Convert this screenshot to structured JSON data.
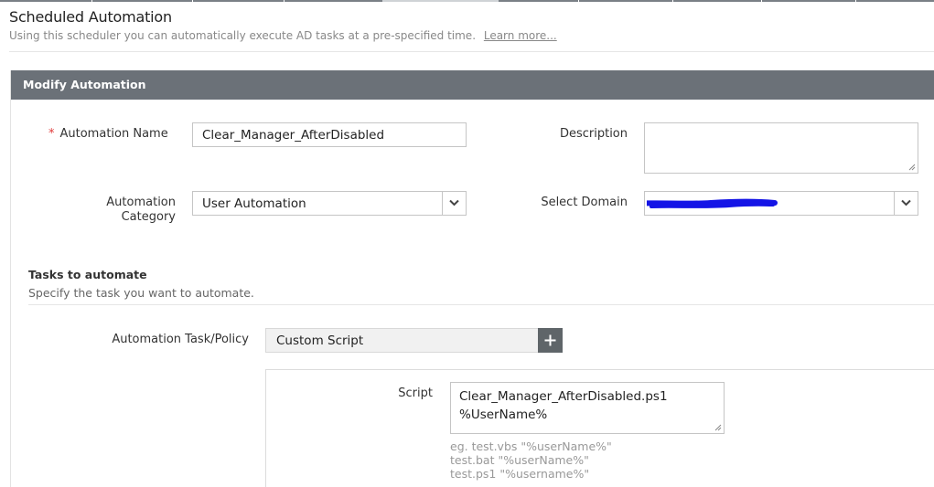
{
  "header": {
    "title": "Scheduled Automation",
    "subtitle": "Using this scheduler you can automatically execute AD tasks at a pre-specified time.",
    "learn_more": "Learn more..."
  },
  "panel": {
    "title": "Modify Automation"
  },
  "form": {
    "automation_name_required": "*",
    "automation_name_label": "Automation Name",
    "automation_name_value": "Clear_Manager_AfterDisabled",
    "description_label": "Description",
    "description_value": "",
    "category_label_line1": "Automation",
    "category_label_line2": "Category",
    "category_value": "User Automation",
    "domain_label": "Select Domain",
    "domain_value": ""
  },
  "tasks": {
    "title": "Tasks to automate",
    "subtitle": "Specify the task you want to automate.",
    "task_label": "Automation Task/Policy",
    "task_value": "Custom Script",
    "add_symbol": "+",
    "script_label": "Script",
    "script_lines": [
      "Clear_Manager_AfterDisabled.ps1",
      "%UserName%"
    ],
    "hints": [
      "eg. test.vbs \"%userName%\"",
      "test.bat \"%userName%\"",
      "test.ps1 \"%username%\""
    ]
  },
  "icons": {
    "dropdown": "chevron-down-icon",
    "add": "plus-icon",
    "resize": "resize-grip-icon",
    "redaction": "redaction-scribble"
  },
  "colors": {
    "panel_header": "#6b7178",
    "required": "#e03b3b",
    "add_button": "#5f6569",
    "redaction": "#1414e6"
  }
}
